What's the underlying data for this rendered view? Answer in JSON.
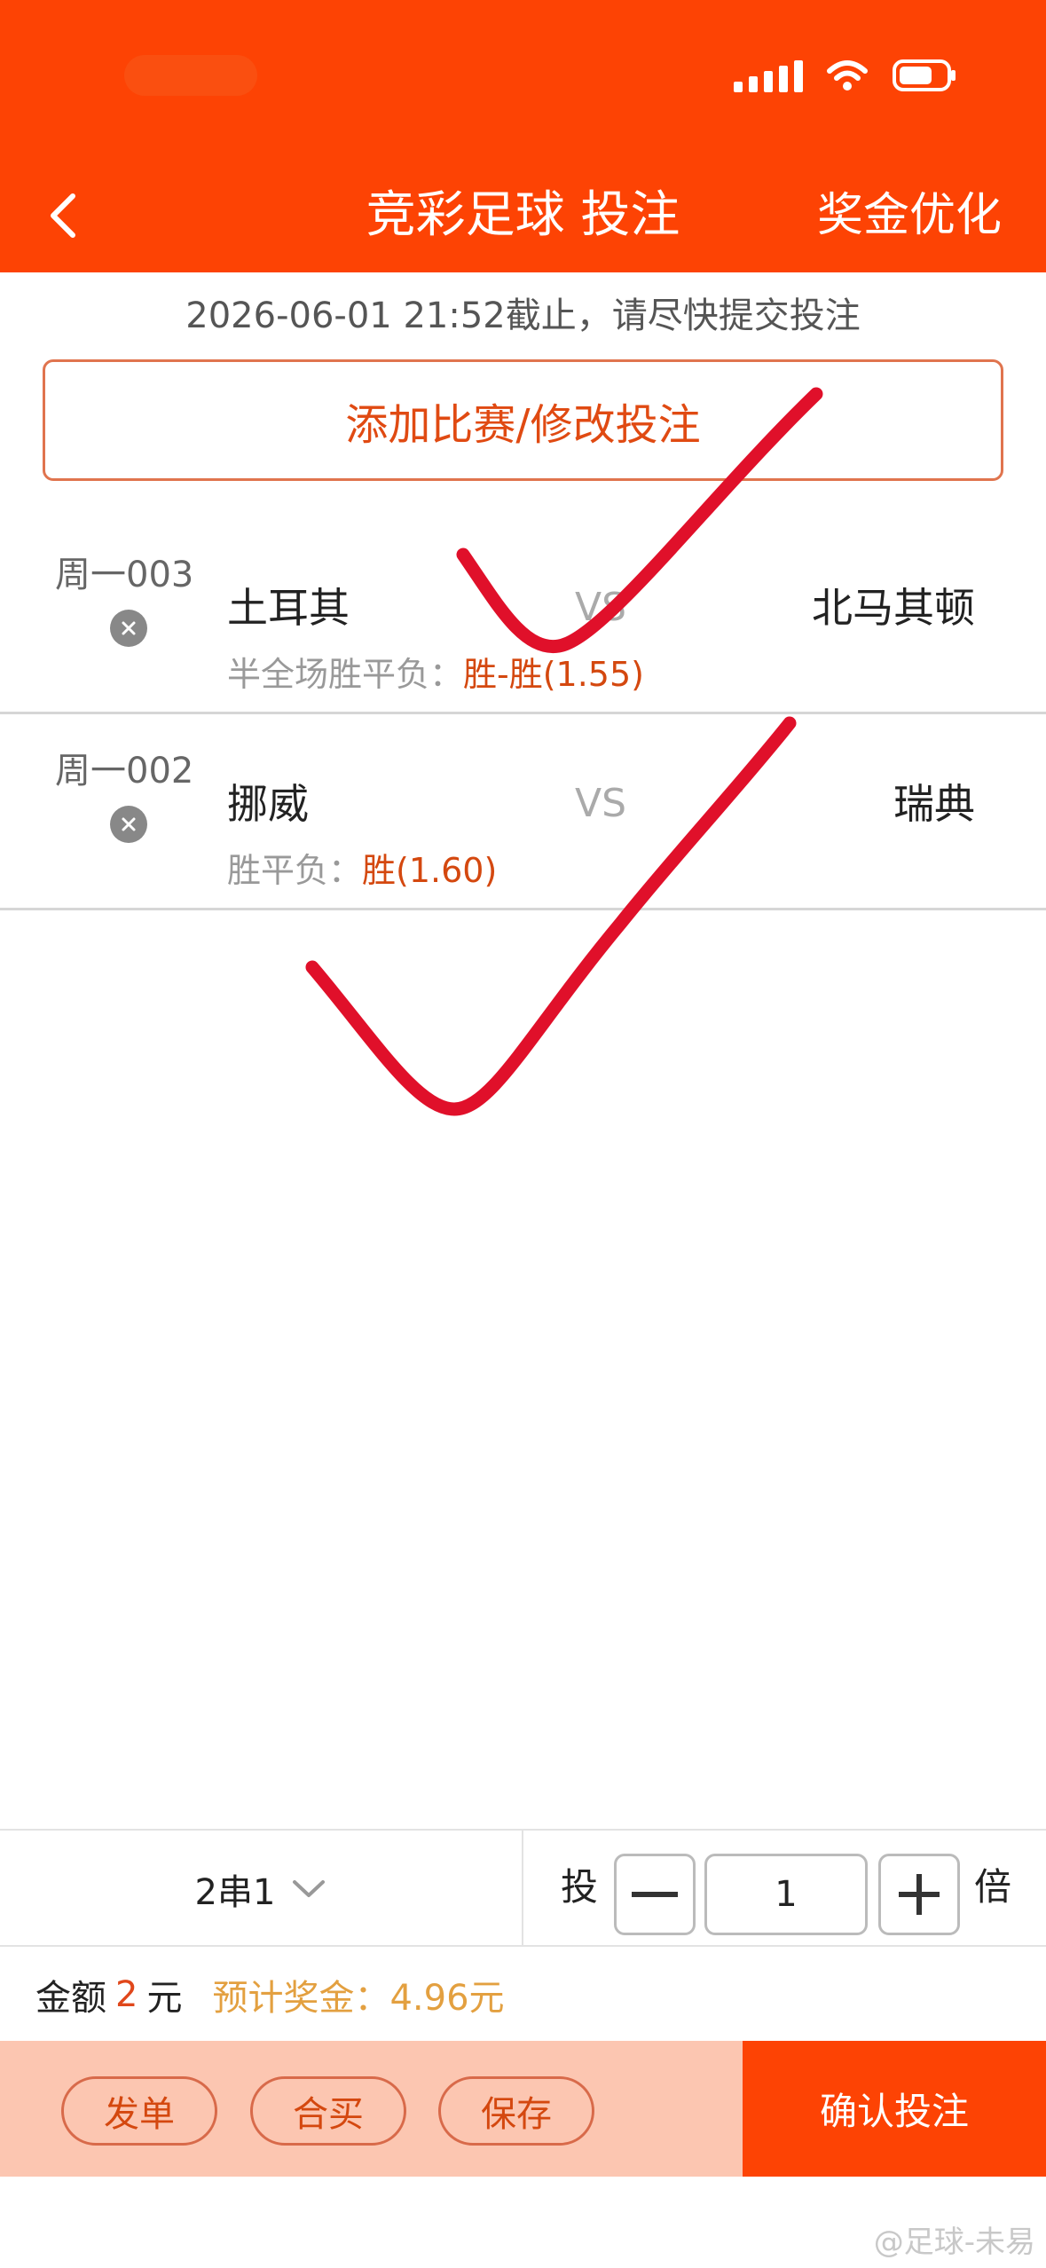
{
  "header": {
    "title": "竞彩足球 投注",
    "optimize_label": "奖金优化"
  },
  "deadline": "2026-06-01 21:52截止，请尽快提交投注",
  "add_button_label": "添加比赛/修改投注",
  "matches": [
    {
      "code": "周一003",
      "home": "土耳其",
      "vs": "VS",
      "away": "北马其顿",
      "play_label": "半全场胜平负：",
      "pick": "胜-胜(1.55)"
    },
    {
      "code": "周一002",
      "home": "挪威",
      "vs": "VS",
      "away": "瑞典",
      "play_label": "胜平负：",
      "pick": "胜(1.60)"
    }
  ],
  "bet": {
    "pass_type": "2串1",
    "multiplier_prefix": "投",
    "multiplier": "1",
    "multiplier_suffix": "倍"
  },
  "summary": {
    "amount_label": "金额",
    "amount": "2",
    "amount_unit": "元",
    "estimate": "预计奖金：4.96元"
  },
  "actions": {
    "publish": "发单",
    "group_buy": "合买",
    "save": "保存",
    "confirm": "确认投注"
  },
  "watermark": "@足球-未易",
  "colors": {
    "brand": "#fd4304",
    "pick": "#d4480f",
    "estimate": "#e3a040",
    "action_bar": "#fcc6b1",
    "check_mark": "#e0102a"
  },
  "icons": [
    "back-arrow-icon",
    "signal-icon",
    "wifi-icon",
    "battery-icon",
    "remove-icon",
    "chevron-down-icon",
    "minus-icon",
    "plus-icon",
    "check-mark"
  ]
}
